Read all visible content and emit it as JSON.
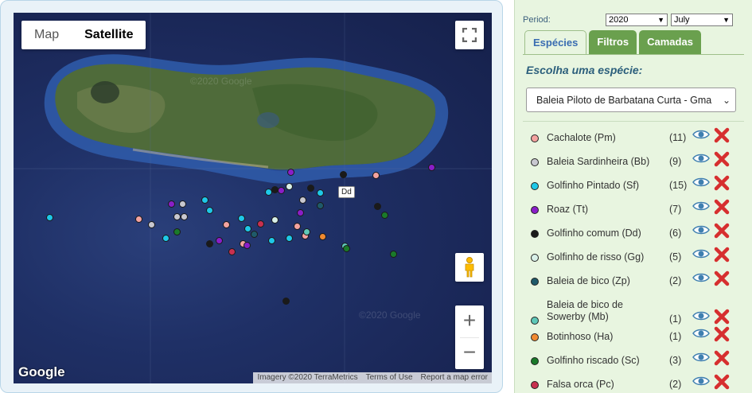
{
  "map": {
    "map_type_buttons": [
      "Map",
      "Satellite"
    ],
    "active_map_type": "Satellite",
    "google_logo": "Google",
    "attribution": [
      "Imagery ©2020 TerraMetrics",
      "Terms of Use",
      "Report a map error"
    ],
    "tooltip": "Dd",
    "zoom_in": "+",
    "zoom_out": "−",
    "watermarks": [
      "©2020 Google",
      "©2020 Google"
    ]
  },
  "panel": {
    "period_label": "Period:",
    "year": "2020",
    "month": "July",
    "tabs": [
      "Espécies",
      "Filtros",
      "Camadas"
    ],
    "active_tab": "Espécies",
    "choose_label": "Escolha uma espécie:",
    "selected_species": "Baleia Piloto de Barbatana Curta - Gma",
    "species": [
      {
        "name": "Cachalote (Pm)",
        "count": "(11)",
        "color": "#f4a3a0"
      },
      {
        "name": "Baleia Sardinheira (Bb)",
        "count": "(9)",
        "color": "#c8c8d0"
      },
      {
        "name": "Golfinho Pintado (Sf)",
        "count": "(15)",
        "color": "#1ec8e8"
      },
      {
        "name": "Roaz (Tt)",
        "count": "(7)",
        "color": "#8a1ec8"
      },
      {
        "name": "Golfinho comum (Dd)",
        "count": "(6)",
        "color": "#1a1a1a"
      },
      {
        "name": "Golfinho de risso (Gg)",
        "count": "(5)",
        "color": "#d8f0e8"
      },
      {
        "name": "Baleia de bico (Zp)",
        "count": "(2)",
        "color": "#1f5a6a"
      },
      {
        "name": "Baleia de bico de Sowerby (Mb)",
        "count": "(1)",
        "color": "#5ec8b8"
      },
      {
        "name": "Botinhoso (Ha)",
        "count": "(1)",
        "color": "#f08a30"
      },
      {
        "name": "Golfinho riscado (Sc)",
        "count": "(3)",
        "color": "#1a7a2a"
      },
      {
        "name": "Falsa orca (Pc)",
        "count": "(2)",
        "color": "#c83050"
      }
    ]
  }
}
